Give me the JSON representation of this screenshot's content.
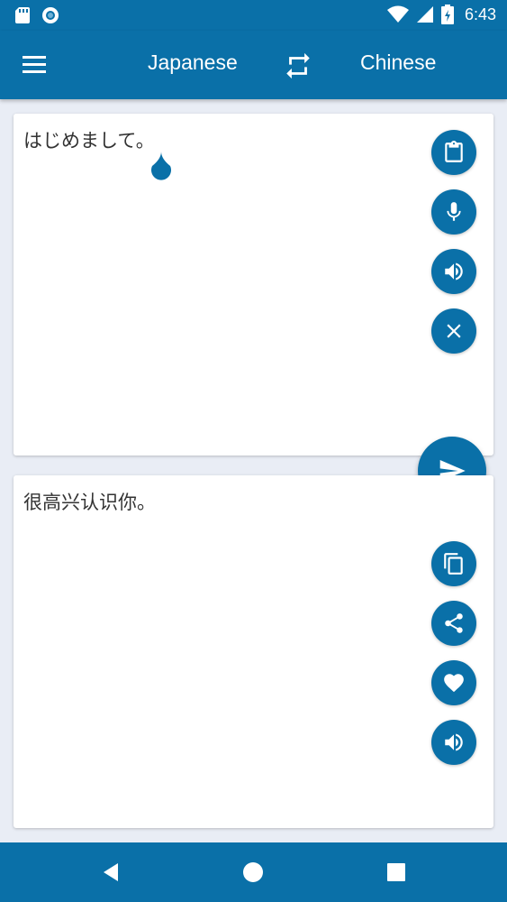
{
  "status_bar": {
    "time": "6:43",
    "icons": [
      "sd-card-icon",
      "circle-notification-icon",
      "wifi-icon",
      "signal-icon",
      "battery-icon"
    ]
  },
  "app_bar": {
    "source_language": "Japanese",
    "target_language": "Chinese",
    "icons": [
      "menu-icon",
      "swap-icon"
    ]
  },
  "source_card": {
    "text": "はじめまして。",
    "buttons": [
      "paste-icon",
      "microphone-icon",
      "speaker-icon",
      "clear-icon"
    ]
  },
  "translate_button": {
    "icon": "send-icon"
  },
  "target_card": {
    "text": "很高兴认识你。",
    "buttons": [
      "copy-icon",
      "share-icon",
      "favorite-icon",
      "speaker-icon"
    ]
  },
  "nav_bar": {
    "icons": [
      "back-icon",
      "home-icon",
      "recents-icon"
    ]
  },
  "colors": {
    "primary": "#0a70a8",
    "background": "#e9edf5",
    "card": "#ffffff",
    "text": "#333333"
  }
}
